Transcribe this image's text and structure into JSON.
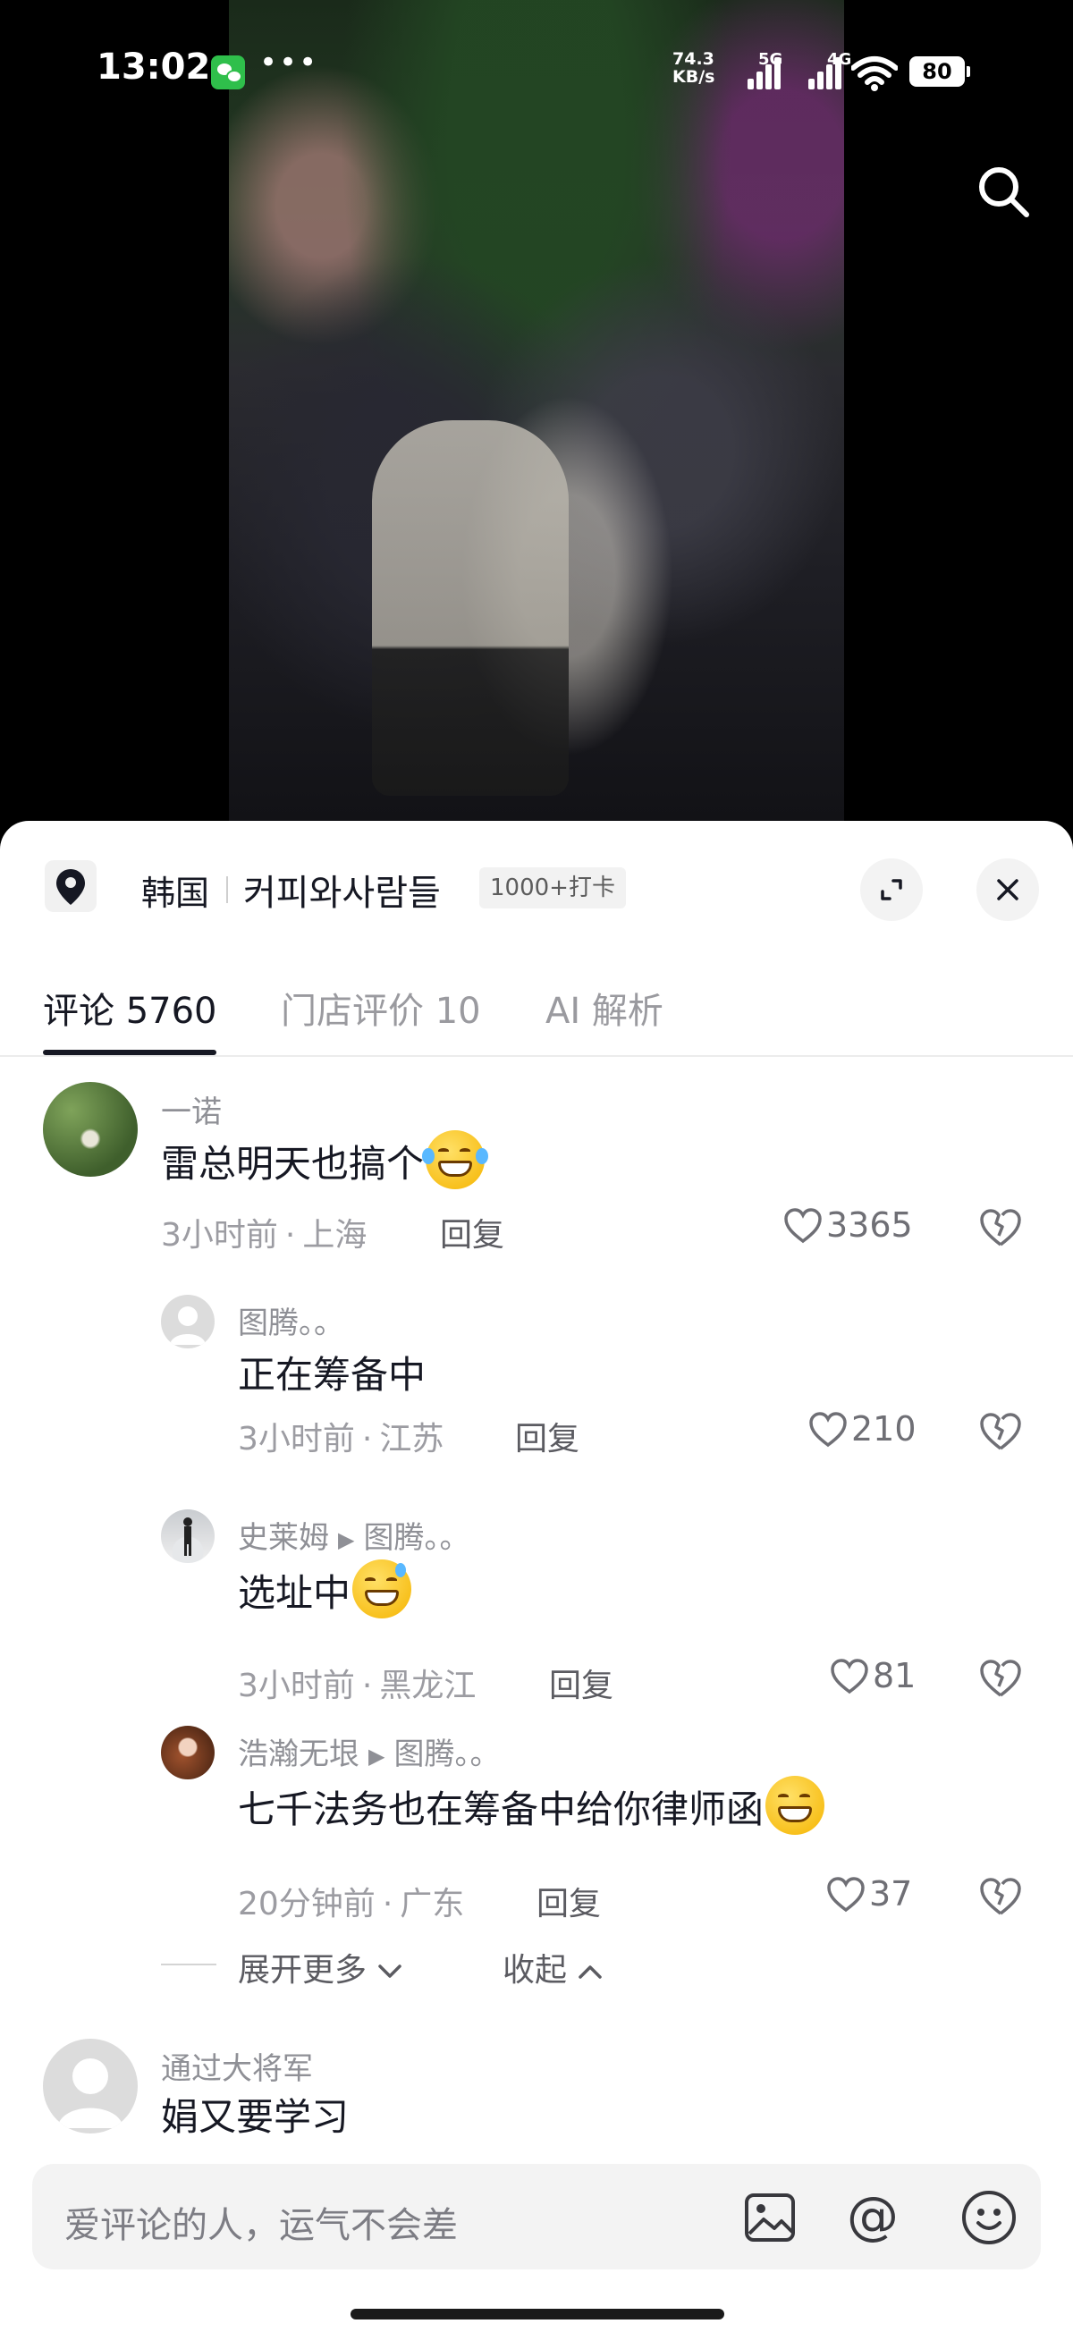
{
  "status_bar": {
    "time": "13:02",
    "net_speed_value": "74.3",
    "net_speed_unit": "KB/s",
    "network_1": "5G",
    "network_2": "4G",
    "battery": "80"
  },
  "location": {
    "country": "韩国",
    "place": "커피와사람들",
    "badge": "1000+打卡"
  },
  "tabs": [
    {
      "label": "评论 5760",
      "active": true
    },
    {
      "label": "门店评价 10",
      "active": false
    },
    {
      "label": "AI 解析",
      "active": false
    }
  ],
  "comments": [
    {
      "user": "一诺",
      "text": "雷总明天也搞个",
      "time": "3小时前",
      "region": "上海",
      "reply": "回复",
      "likes": "3365"
    },
    {
      "user": "图腾。。",
      "text": "正在筹备中",
      "time": "3小时前",
      "region": "江苏",
      "reply": "回复",
      "likes": "210"
    },
    {
      "user": "史莱姆",
      "reply_to": "图腾。。",
      "text": "选址中",
      "time": "3小时前",
      "region": "黑龙江",
      "reply": "回复",
      "likes": "81"
    },
    {
      "user": "浩瀚无垠",
      "reply_to": "图腾。。",
      "text": "七千法务也在筹备中给你律师函",
      "time": "20分钟前",
      "region": "广东",
      "reply": "回复",
      "likes": "37"
    },
    {
      "user": "通过大将军",
      "text": "娟又要学习"
    }
  ],
  "thread_controls": {
    "expand_more": "展开更多",
    "collapse": "收起"
  },
  "input": {
    "placeholder": "爱评论的人，运气不会差"
  },
  "colors": {
    "text_primary": "#161823",
    "text_secondary": "#8f9096",
    "sheet_bg": "#ffffff",
    "battery_bg": "#ffffff"
  },
  "icons": [
    "wechat-icon",
    "search-icon",
    "location-pin-icon",
    "expand-icon",
    "close-icon",
    "heart-icon",
    "broken-heart-icon",
    "chevron-down-icon",
    "chevron-up-icon",
    "image-icon",
    "at-icon",
    "smiley-icon"
  ]
}
